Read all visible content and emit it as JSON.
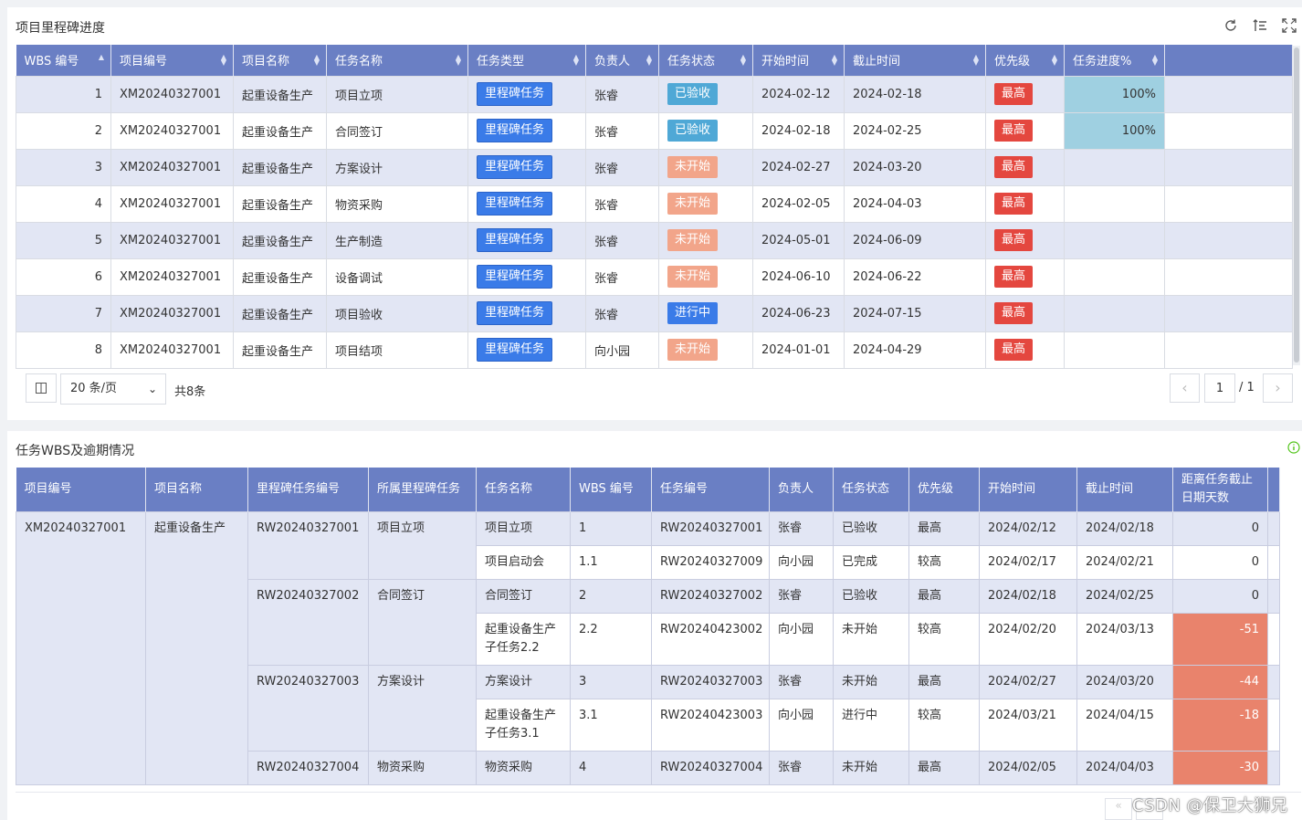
{
  "panel1": {
    "title": "项目里程碑进度",
    "columns": [
      "WBS 编号",
      "项目编号",
      "项目名称",
      "任务名称",
      "任务类型",
      "负责人",
      "任务状态",
      "开始时间",
      "截止时间",
      "优先级",
      "任务进度%"
    ],
    "rows": [
      {
        "wbs": "1",
        "project_no": "XM20240327001",
        "project_name": "起重设备生产",
        "task_name": "项目立项",
        "task_type": "里程碑任务",
        "owner": "张睿",
        "status": "已验收",
        "status_kind": "accepted",
        "start": "2024-02-12",
        "end": "2024-02-18",
        "priority": "最高",
        "progress": "100%"
      },
      {
        "wbs": "2",
        "project_no": "XM20240327001",
        "project_name": "起重设备生产",
        "task_name": "合同签订",
        "task_type": "里程碑任务",
        "owner": "张睿",
        "status": "已验收",
        "status_kind": "accepted",
        "start": "2024-02-18",
        "end": "2024-02-25",
        "priority": "最高",
        "progress": "100%"
      },
      {
        "wbs": "3",
        "project_no": "XM20240327001",
        "project_name": "起重设备生产",
        "task_name": "方案设计",
        "task_type": "里程碑任务",
        "owner": "张睿",
        "status": "未开始",
        "status_kind": "notstarted",
        "start": "2024-02-27",
        "end": "2024-03-20",
        "priority": "最高",
        "progress": ""
      },
      {
        "wbs": "4",
        "project_no": "XM20240327001",
        "project_name": "起重设备生产",
        "task_name": "物资采购",
        "task_type": "里程碑任务",
        "owner": "张睿",
        "status": "未开始",
        "status_kind": "notstarted",
        "start": "2024-02-05",
        "end": "2024-04-03",
        "priority": "最高",
        "progress": ""
      },
      {
        "wbs": "5",
        "project_no": "XM20240327001",
        "project_name": "起重设备生产",
        "task_name": "生产制造",
        "task_type": "里程碑任务",
        "owner": "张睿",
        "status": "未开始",
        "status_kind": "notstarted",
        "start": "2024-05-01",
        "end": "2024-06-09",
        "priority": "最高",
        "progress": ""
      },
      {
        "wbs": "6",
        "project_no": "XM20240327001",
        "project_name": "起重设备生产",
        "task_name": "设备调试",
        "task_type": "里程碑任务",
        "owner": "张睿",
        "status": "未开始",
        "status_kind": "notstarted",
        "start": "2024-06-10",
        "end": "2024-06-22",
        "priority": "最高",
        "progress": ""
      },
      {
        "wbs": "7",
        "project_no": "XM20240327001",
        "project_name": "起重设备生产",
        "task_name": "项目验收",
        "task_type": "里程碑任务",
        "owner": "张睿",
        "status": "进行中",
        "status_kind": "inprogress",
        "start": "2024-06-23",
        "end": "2024-07-15",
        "priority": "最高",
        "progress": ""
      },
      {
        "wbs": "8",
        "project_no": "XM20240327001",
        "project_name": "起重设备生产",
        "task_name": "项目结项",
        "task_type": "里程碑任务",
        "owner": "向小园",
        "status": "未开始",
        "status_kind": "notstarted",
        "start": "2024-01-01",
        "end": "2024-04-29",
        "priority": "最高",
        "progress": ""
      }
    ],
    "pager": {
      "page_size": "20 条/页",
      "total": "共8条",
      "current": "1",
      "of": "/ 1",
      "prev": "‹",
      "next": "›"
    }
  },
  "panel2": {
    "title": "任务WBS及逾期情况",
    "columns": [
      "项目编号",
      "项目名称",
      "里程碑任务编号",
      "所属里程碑任务",
      "任务名称",
      "WBS 编号",
      "任务编号",
      "负责人",
      "任务状态",
      "优先级",
      "开始时间",
      "截止时间",
      "距离任务截止日期天数"
    ],
    "project_no": "XM20240327001",
    "project_name": "起重设备生产",
    "milestones": [
      {
        "code": "RW20240327001",
        "name": "项目立项",
        "tasks": [
          {
            "name": "项目立项",
            "wbs": "1",
            "task_no": "RW20240327001",
            "owner": "张睿",
            "status": "已验收",
            "priority": "最高",
            "start": "2024/02/12",
            "end": "2024/02/18",
            "days": "0",
            "overdue": false
          },
          {
            "name": "项目启动会",
            "wbs": "1.1",
            "task_no": "RW20240327009",
            "owner": "向小园",
            "status": "已完成",
            "priority": "较高",
            "start": "2024/02/17",
            "end": "2024/02/21",
            "days": "0",
            "overdue": false
          }
        ]
      },
      {
        "code": "RW20240327002",
        "name": "合同签订",
        "tasks": [
          {
            "name": "合同签订",
            "wbs": "2",
            "task_no": "RW20240327002",
            "owner": "张睿",
            "status": "已验收",
            "priority": "最高",
            "start": "2024/02/18",
            "end": "2024/02/25",
            "days": "0",
            "overdue": false
          },
          {
            "name": "起重设备生产子任务2.2",
            "wbs": "2.2",
            "task_no": "RW20240423002",
            "owner": "向小园",
            "status": "未开始",
            "priority": "较高",
            "start": "2024/02/20",
            "end": "2024/03/13",
            "days": "-51",
            "overdue": true
          }
        ]
      },
      {
        "code": "RW20240327003",
        "name": "方案设计",
        "tasks": [
          {
            "name": "方案设计",
            "wbs": "3",
            "task_no": "RW20240327003",
            "owner": "张睿",
            "status": "未开始",
            "priority": "最高",
            "start": "2024/02/27",
            "end": "2024/03/20",
            "days": "-44",
            "overdue": true
          },
          {
            "name": "起重设备生产子任务3.1",
            "wbs": "3.1",
            "task_no": "RW20240423003",
            "owner": "向小园",
            "status": "进行中",
            "priority": "较高",
            "start": "2024/03/21",
            "end": "2024/04/15",
            "days": "-18",
            "overdue": true
          }
        ]
      },
      {
        "code": "RW20240327004",
        "name": "物资采购",
        "tasks": [
          {
            "name": "物资采购",
            "wbs": "4",
            "task_no": "RW20240327004",
            "owner": "张睿",
            "status": "未开始",
            "priority": "最高",
            "start": "2024/02/05",
            "end": "2024/04/03",
            "days": "-30",
            "overdue": true
          }
        ]
      }
    ]
  },
  "watermark": "CSDN @保卫大狮兄",
  "colors": {
    "header": "#6a7fc4",
    "row_alt": "#e2e6f4",
    "milestone_tag": "#3a7be8",
    "accepted_tag": "#4fa8d6",
    "notstarted_tag": "#f2a58a",
    "priority_tag": "#e4473f",
    "overdue_cell": "#e9836c",
    "progress_cell": "#9fd0e1"
  },
  "icons": [
    "refresh-icon",
    "column-settings-icon",
    "fullscreen-icon",
    "column-toggle-icon",
    "chevron-down-icon",
    "info-icon"
  ]
}
